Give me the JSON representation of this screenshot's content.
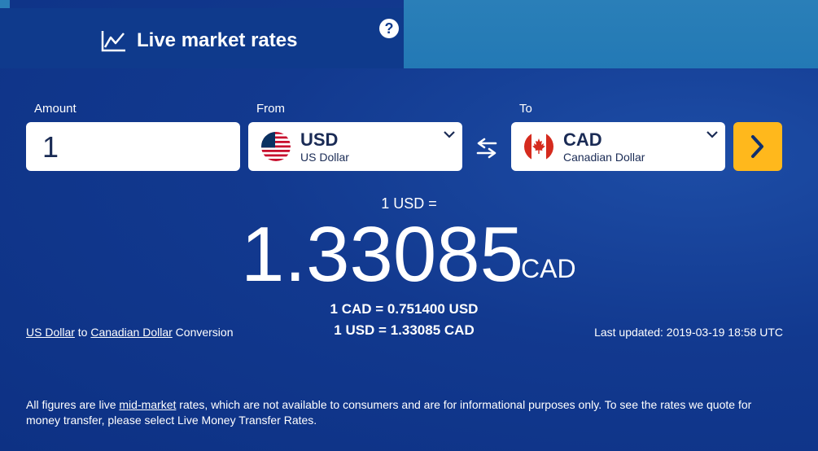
{
  "tabs": {
    "active_label": "Live market rates"
  },
  "labels": {
    "amount": "Amount",
    "from": "From",
    "to": "To"
  },
  "amount": {
    "value": "1"
  },
  "from_currency": {
    "code": "USD",
    "name": "US Dollar",
    "flag_icon": "us-flag-icon"
  },
  "to_currency": {
    "code": "CAD",
    "name": "Canadian Dollar",
    "flag_icon": "canada-flag-icon"
  },
  "result": {
    "base": "1 USD =",
    "rate": "1.33085",
    "unit": "CAD",
    "inverse_line": "1 CAD = 0.751400 USD",
    "direct_line": "1 USD = 1.33085 CAD"
  },
  "conversion_link": {
    "from_link": "US Dollar",
    "to_word": " to ",
    "to_link": "Canadian Dollar",
    "suffix": " Conversion"
  },
  "last_updated": "Last updated: 2019-03-19 18:58 UTC",
  "disclaimer": {
    "prefix": "All figures are live ",
    "link": "mid-market",
    "suffix": " rates, which are not available to consumers and are for informational purposes only. To see the rates we quote for money transfer, please select Live Money Transfer Rates."
  },
  "colors": {
    "panel": "#0f3a8c",
    "tab_bar": "#2a7fb8",
    "go_button": "#ffb81c",
    "text": "#ffffff"
  }
}
